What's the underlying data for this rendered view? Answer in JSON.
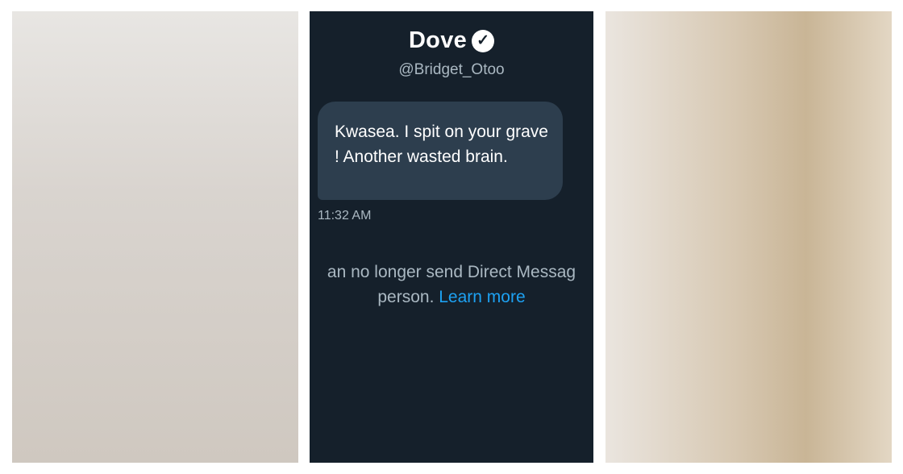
{
  "dm": {
    "name": "Dove",
    "verified_icon": "verified-badge-icon",
    "handle": "@Bridget_Otoo",
    "message": "Kwasea. I spit on your grave ! Another wasted brain.",
    "time": "11:32 AM",
    "notice_line1": "an no longer send Direct Messag",
    "notice_line2_prefix": "person. ",
    "learn_more": "Learn more"
  },
  "colors": {
    "dm_background": "#15202b",
    "bubble": "#2d3e4e",
    "link": "#1da1f2",
    "muted_text": "#aab8c2",
    "left_dress": "#2a3bb0",
    "right_outfit": "#121212"
  }
}
